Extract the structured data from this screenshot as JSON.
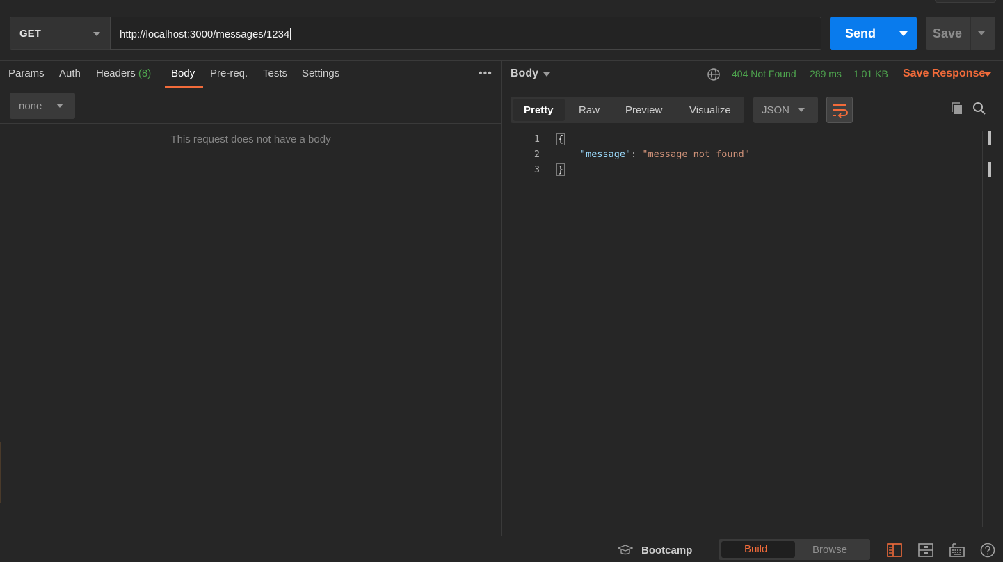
{
  "request": {
    "method": "GET",
    "url": "http://localhost:3000/messages/1234",
    "send_label": "Send",
    "save_label": "Save"
  },
  "request_tabs": [
    {
      "label": "Params"
    },
    {
      "label": "Auth"
    },
    {
      "label": "Headers",
      "count": "(8)"
    },
    {
      "label": "Body",
      "active": true
    },
    {
      "label": "Pre-req."
    },
    {
      "label": "Tests"
    },
    {
      "label": "Settings"
    }
  ],
  "body": {
    "type": "none",
    "empty_message": "This request does not have a body"
  },
  "response": {
    "section_label": "Body",
    "status": "404 Not Found",
    "time": "289 ms",
    "size": "1.01 KB",
    "save_response_label": "Save Response",
    "view_tabs": [
      "Pretty",
      "Raw",
      "Preview",
      "Visualize"
    ],
    "active_view": "Pretty",
    "format": "JSON",
    "lines": [
      {
        "number": "1",
        "text": "{"
      },
      {
        "number": "2",
        "key": "\"message\"",
        "value": "\"message not found\""
      },
      {
        "number": "3",
        "text": "}"
      }
    ]
  },
  "footer": {
    "bootcamp_label": "Bootcamp",
    "build_label": "Build",
    "browse_label": "Browse"
  },
  "colors": {
    "accent": "#f26b3a",
    "send_blue": "#097bed",
    "success_green": "#4ea44e",
    "background": "#262626"
  },
  "icons": [
    "globe-icon",
    "copy-icon",
    "search-icon",
    "wrap-lines-icon",
    "bootcamp-icon",
    "two-pane-icon",
    "find-replace-icon",
    "keyboard-icon",
    "help-icon",
    "more-options-icon"
  ]
}
